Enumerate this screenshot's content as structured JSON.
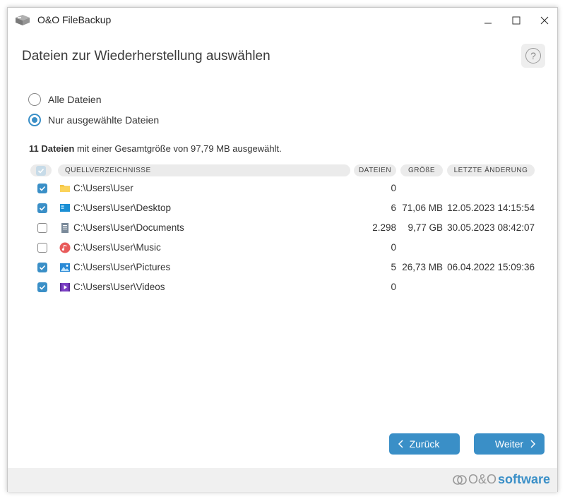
{
  "window": {
    "title": "O&O FileBackup"
  },
  "header": {
    "title": "Dateien zur Wiederherstellung auswählen",
    "help_label": "?"
  },
  "options": {
    "all_files": "Alle Dateien",
    "selected_files": "Nur ausgewählte Dateien",
    "selected": "selected_files"
  },
  "summary": {
    "count": "11 Dateien",
    "rest": " mit einer Gesamtgröße von 97,79 MB ausgewählt."
  },
  "table": {
    "columns": {
      "source": "QUELLVERZEICHNISSE",
      "files": "DATEIEN",
      "size": "GRÖßE",
      "modified": "LETZTE ÄNDERUNG"
    },
    "rows": [
      {
        "checked": true,
        "icon": "folder-icon",
        "path": "C:\\Users\\User",
        "files": "0",
        "size": "",
        "modified": ""
      },
      {
        "checked": true,
        "icon": "desktop-icon",
        "path": "C:\\Users\\User\\Desktop",
        "files": "6",
        "size": "71,06 MB",
        "modified": "12.05.2023 14:15:54"
      },
      {
        "checked": false,
        "icon": "documents-icon",
        "path": "C:\\Users\\User\\Documents",
        "files": "2.298",
        "size": "9,77 GB",
        "modified": "30.05.2023 08:42:07"
      },
      {
        "checked": false,
        "icon": "music-icon",
        "path": "C:\\Users\\User\\Music",
        "files": "0",
        "size": "",
        "modified": ""
      },
      {
        "checked": true,
        "icon": "pictures-icon",
        "path": "C:\\Users\\User\\Pictures",
        "files": "5",
        "size": "26,73 MB",
        "modified": "06.04.2022 15:09:36"
      },
      {
        "checked": true,
        "icon": "videos-icon",
        "path": "C:\\Users\\User\\Videos",
        "files": "0",
        "size": "",
        "modified": ""
      }
    ]
  },
  "buttons": {
    "back": "Zurück",
    "next": "Weiter"
  },
  "footer": {
    "brand_prefix": "O&O",
    "brand_name": "software"
  },
  "colors": {
    "accent": "#3a8fc7"
  }
}
